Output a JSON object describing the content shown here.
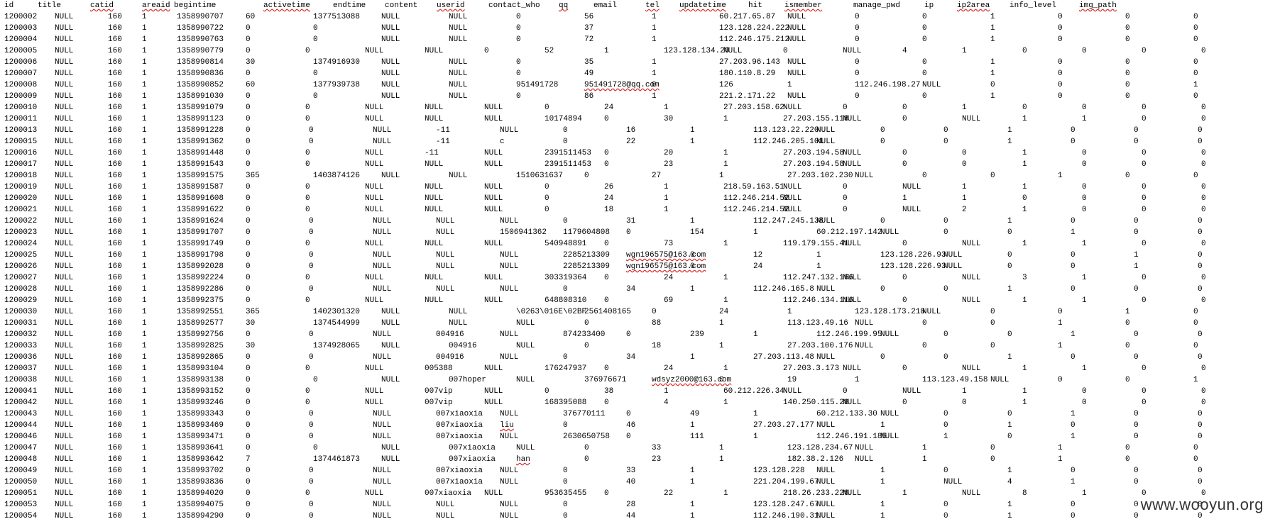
{
  "watermark": "www.wooyun.org",
  "header": [
    "id",
    "title",
    "catid",
    "areaid",
    "begintime",
    "activetime",
    "endtime",
    "content",
    "userid",
    "contact_who",
    "qq",
    "email",
    "tel",
    "updatetime",
    "hit",
    "ismember",
    "manage_pwd",
    "ip",
    "ip2area",
    "info_level",
    "img_path"
  ],
  "header_spellcheck": [
    "catid",
    "areaid",
    "activetime",
    "userid",
    "qq",
    "tel",
    "updatetime",
    "ismember",
    "ip2area",
    "img_path"
  ],
  "spellcheck_cells": [
    "@qq.com",
    "@163.com",
    "liu",
    "han"
  ],
  "rows": [
    [
      "1200002",
      "NULL",
      "160",
      "1",
      "1358990707",
      "60",
      "1377513088",
      "NULL",
      "NULL",
      "0",
      "56",
      "1",
      "60.217.65.87",
      "NULL",
      "0",
      "0",
      "1",
      "0",
      "0",
      "0"
    ],
    [
      "1200003",
      "NULL",
      "160",
      "1",
      "1358990722",
      "0",
      "0",
      "NULL",
      "NULL",
      "0",
      "37",
      "1",
      "123.128.224.222",
      "NULL",
      "0",
      "0",
      "1",
      "0",
      "0",
      "0"
    ],
    [
      "1200004",
      "NULL",
      "160",
      "1",
      "1358990763",
      "0",
      "0",
      "NULL",
      "NULL",
      "0",
      "72",
      "1",
      "112.246.175.212",
      "NULL",
      "0",
      "0",
      "1",
      "0",
      "0",
      "0"
    ],
    [
      "1200005",
      "NULL",
      "160",
      "1",
      "1358990779",
      "0",
      "0",
      "NULL",
      "NULL",
      "0",
      "52",
      "1",
      "123.128.134.20",
      "NULL",
      "0",
      "NULL",
      "4",
      "1",
      "0",
      "0",
      "0",
      "0"
    ],
    [
      "1200006",
      "NULL",
      "160",
      "1",
      "1358990814",
      "30",
      "1374916930",
      "NULL",
      "NULL",
      "0",
      "35",
      "1",
      "27.203.96.143",
      "NULL",
      "0",
      "0",
      "1",
      "0",
      "0",
      "0"
    ],
    [
      "1200007",
      "NULL",
      "160",
      "1",
      "1358990836",
      "0",
      "0",
      "NULL",
      "NULL",
      "0",
      "49",
      "1",
      "180.110.8.29",
      "NULL",
      "0",
      "0",
      "1",
      "0",
      "0",
      "0"
    ],
    [
      "1200008",
      "NULL",
      "160",
      "1",
      "1358990852",
      "60",
      "1377939738",
      "NULL",
      "NULL",
      "951491728",
      "951491728@qq.com",
      "0",
      "126",
      "1",
      "112.246.198.27",
      "NULL",
      "0",
      "0",
      "0",
      "1"
    ],
    [
      "1200009",
      "NULL",
      "160",
      "1",
      "1358991030",
      "0",
      "0",
      "NULL",
      "NULL",
      "0",
      "86",
      "1",
      "221.2.171.22",
      "NULL",
      "0",
      "0",
      "1",
      "0",
      "0",
      "0"
    ],
    [
      "1200010",
      "NULL",
      "160",
      "1",
      "1358991079",
      "0",
      "0",
      "NULL",
      "NULL",
      "NULL",
      "0",
      "24",
      "1",
      "27.203.158.62",
      "NULL",
      "0",
      "0",
      "1",
      "0",
      "0",
      "0",
      "0"
    ],
    [
      "1200011",
      "NULL",
      "160",
      "1",
      "1358991123",
      "0",
      "0",
      "NULL",
      "NULL",
      "NULL",
      "10174894",
      "0",
      "30",
      "1",
      "27.203.155.118",
      "NULL",
      "0",
      "NULL",
      "1",
      "1",
      "0",
      "0"
    ],
    [
      "1200013",
      "NULL",
      "160",
      "1",
      "1358991228",
      "0",
      "0",
      "NULL",
      "-11",
      "NULL",
      "0",
      "16",
      "1",
      "113.123.22.220",
      "NULL",
      "0",
      "0",
      "1",
      "0",
      "0",
      "0"
    ],
    [
      "1200015",
      "NULL",
      "160",
      "1",
      "1358991362",
      "0",
      "0",
      "NULL",
      "-11",
      "c",
      "0",
      "22",
      "1",
      "112.246.205.101",
      "NULL",
      "0",
      "0",
      "1",
      "0",
      "0",
      "0"
    ],
    [
      "1200016",
      "NULL",
      "160",
      "1",
      "1358991448",
      "0",
      "0",
      "NULL",
      "-11",
      "NULL",
      "2391511453",
      "0",
      "20",
      "1",
      "27.203.194.58",
      "NULL",
      "0",
      "0",
      "1",
      "0",
      "0",
      "0"
    ],
    [
      "1200017",
      "NULL",
      "160",
      "1",
      "1358991543",
      "0",
      "0",
      "NULL",
      "NULL",
      "NULL",
      "2391511453",
      "0",
      "23",
      "1",
      "27.203.194.58",
      "NULL",
      "0",
      "0",
      "1",
      "0",
      "0",
      "0"
    ],
    [
      "1200018",
      "NULL",
      "160",
      "1",
      "1358991575",
      "365",
      "1403874126",
      "NULL",
      "NULL",
      "1510631637",
      "0",
      "27",
      "1",
      "27.203.102.230",
      "NULL",
      "0",
      "0",
      "1",
      "0",
      "0"
    ],
    [
      "1200019",
      "NULL",
      "160",
      "1",
      "1358991587",
      "0",
      "0",
      "NULL",
      "NULL",
      "NULL",
      "0",
      "26",
      "1",
      "218.59.163.51",
      "NULL",
      "0",
      "NULL",
      "1",
      "1",
      "0",
      "0",
      "0"
    ],
    [
      "1200020",
      "NULL",
      "160",
      "1",
      "1358991608",
      "0",
      "0",
      "NULL",
      "NULL",
      "NULL",
      "0",
      "24",
      "1",
      "112.246.214.52",
      "NULL",
      "0",
      "1",
      "1",
      "0",
      "0",
      "0",
      "0"
    ],
    [
      "1200021",
      "NULL",
      "160",
      "1",
      "1358991622",
      "0",
      "0",
      "NULL",
      "NULL",
      "NULL",
      "0",
      "18",
      "1",
      "112.246.214.52",
      "NULL",
      "0",
      "NULL",
      "2",
      "1",
      "0",
      "0",
      "0"
    ],
    [
      "1200022",
      "NULL",
      "160",
      "1",
      "1358991624",
      "0",
      "0",
      "NULL",
      "NULL",
      "NULL",
      "0",
      "31",
      "1",
      "112.247.245.138",
      "NULL",
      "0",
      "0",
      "1",
      "0",
      "0",
      "0"
    ],
    [
      "1200023",
      "NULL",
      "160",
      "1",
      "1358991707",
      "0",
      "0",
      "NULL",
      "NULL",
      "1506941362",
      "1179604808",
      "0",
      "154",
      "1",
      "60.212.197.142",
      "NULL",
      "0",
      "0",
      "1",
      "0",
      "0"
    ],
    [
      "1200024",
      "NULL",
      "160",
      "1",
      "1358991749",
      "0",
      "0",
      "NULL",
      "NULL",
      "NULL",
      "540948891",
      "0",
      "73",
      "1",
      "119.179.155.41",
      "NULL",
      "0",
      "NULL",
      "1",
      "1",
      "0",
      "0"
    ],
    [
      "1200025",
      "NULL",
      "160",
      "1",
      "1358991798",
      "0",
      "0",
      "NULL",
      "NULL",
      "NULL",
      "2285213309",
      "wgn196575@163.com",
      "0",
      "12",
      "1",
      "123.128.226.93",
      "NULL",
      "0",
      "0",
      "1",
      "0"
    ],
    [
      "1200026",
      "NULL",
      "160",
      "1",
      "1358992028",
      "0",
      "0",
      "NULL",
      "NULL",
      "NULL",
      "2285213309",
      "wgn196575@163.com",
      "0",
      "24",
      "1",
      "123.128.226.93",
      "NULL",
      "0",
      "0",
      "1",
      "0"
    ],
    [
      "1200027",
      "NULL",
      "160",
      "1",
      "1358992224",
      "0",
      "0",
      "NULL",
      "NULL",
      "NULL",
      "303319364",
      "0",
      "24",
      "1",
      "112.247.132.166",
      "NULL",
      "0",
      "NULL",
      "3",
      "1",
      "0",
      "0"
    ],
    [
      "1200028",
      "NULL",
      "160",
      "1",
      "1358992286",
      "0",
      "0",
      "NULL",
      "NULL",
      "NULL",
      "0",
      "34",
      "1",
      "112.246.165.8",
      "NULL",
      "0",
      "0",
      "1",
      "0",
      "0",
      "0"
    ],
    [
      "1200029",
      "NULL",
      "160",
      "1",
      "1358992375",
      "0",
      "0",
      "NULL",
      "NULL",
      "NULL",
      "648808310",
      "0",
      "69",
      "1",
      "112.246.134.116",
      "NULL",
      "0",
      "NULL",
      "1",
      "1",
      "0",
      "0"
    ],
    [
      "1200030",
      "NULL",
      "160",
      "1",
      "1358992551",
      "365",
      "1402301320",
      "NULL",
      "NULL",
      "\\0263\\016E\\02BF",
      "2561408165",
      "0",
      "24",
      "1",
      "123.128.173.218",
      "NULL",
      "0",
      "0",
      "1",
      "0"
    ],
    [
      "1200031",
      "NULL",
      "160",
      "1",
      "1358992577",
      "30",
      "1374544999",
      "NULL",
      "NULL",
      "NULL",
      "0",
      "88",
      "1",
      "113.123.49.16",
      "NULL",
      "0",
      "0",
      "1",
      "0",
      "0"
    ],
    [
      "1200032",
      "NULL",
      "160",
      "1",
      "1358992756",
      "0",
      "0",
      "NULL",
      "004916",
      "NULL",
      "874233400",
      "0",
      "239",
      "1",
      "112.246.199.95",
      "NULL",
      "0",
      "0",
      "1",
      "0",
      "0"
    ],
    [
      "1200033",
      "NULL",
      "160",
      "1",
      "1358992825",
      "30",
      "1374928065",
      "NULL",
      "004916",
      "NULL",
      "0",
      "18",
      "1",
      "27.203.100.176",
      "NULL",
      "0",
      "0",
      "1",
      "0",
      "0"
    ],
    [
      "1200036",
      "NULL",
      "160",
      "1",
      "1358992865",
      "0",
      "0",
      "NULL",
      "004916",
      "NULL",
      "0",
      "34",
      "1",
      "27.203.113.48",
      "NULL",
      "0",
      "0",
      "1",
      "0",
      "0",
      "0"
    ],
    [
      "1200037",
      "NULL",
      "160",
      "1",
      "1358993104",
      "0",
      "0",
      "NULL",
      "005388",
      "NULL",
      "176247937",
      "0",
      "24",
      "1",
      "27.203.3.173",
      "NULL",
      "0",
      "NULL",
      "1",
      "1",
      "0",
      "0"
    ],
    [
      "1200038",
      "NULL",
      "160",
      "1",
      "1358993138",
      "0",
      "0",
      "NULL",
      "007hoper",
      "NULL",
      "376976671",
      "wdsyz2000@163.com",
      "0",
      "19",
      "1",
      "113.123.49.158",
      "NULL",
      "0",
      "0",
      "1"
    ],
    [
      "1200041",
      "NULL",
      "160",
      "1",
      "1358993152",
      "0",
      "0",
      "NULL",
      "007vip",
      "NULL",
      "0",
      "38",
      "1",
      "60.212.226.34",
      "NULL",
      "0",
      "NULL",
      "1",
      "1",
      "0",
      "0",
      "0"
    ],
    [
      "1200042",
      "NULL",
      "160",
      "1",
      "1358993246",
      "0",
      "0",
      "NULL",
      "007vip",
      "NULL",
      "168395088",
      "0",
      "4",
      "1",
      "140.250.115.28",
      "NULL",
      "0",
      "0",
      "1",
      "0",
      "0",
      "0"
    ],
    [
      "1200043",
      "NULL",
      "160",
      "1",
      "1358993343",
      "0",
      "0",
      "NULL",
      "007xiaoxia",
      "NULL",
      "376770111",
      "0",
      "49",
      "1",
      "60.212.133.30",
      "NULL",
      "0",
      "0",
      "1",
      "0",
      "0"
    ],
    [
      "1200044",
      "NULL",
      "160",
      "1",
      "1358993469",
      "0",
      "0",
      "NULL",
      "007xiaoxia",
      "liu",
      "0",
      "46",
      "1",
      "27.203.27.177",
      "NULL",
      "1",
      "0",
      "1",
      "0",
      "0",
      "0"
    ],
    [
      "1200046",
      "NULL",
      "160",
      "1",
      "1358993471",
      "0",
      "0",
      "NULL",
      "007xiaoxia",
      "NULL",
      "2630650758",
      "0",
      "111",
      "1",
      "112.246.191.185",
      "NULL",
      "1",
      "0",
      "1",
      "0",
      "0"
    ],
    [
      "1200047",
      "NULL",
      "160",
      "1",
      "1358993641",
      "0",
      "0",
      "NULL",
      "007xiaoxia",
      "NULL",
      "0",
      "33",
      "1",
      "123.128.234.67",
      "NULL",
      "1",
      "0",
      "1",
      "0",
      "0"
    ],
    [
      "1200048",
      "NULL",
      "160",
      "1",
      "1358993642",
      "7",
      "1374461873",
      "NULL",
      "007xiaoxia",
      "han",
      "0",
      "23",
      "1",
      "182.38.2.126",
      "NULL",
      "1",
      "0",
      "1",
      "0",
      "0"
    ],
    [
      "1200049",
      "NULL",
      "160",
      "1",
      "1358993702",
      "0",
      "0",
      "NULL",
      "007xiaoxia",
      "NULL",
      "0",
      "33",
      "1",
      "123.128.228",
      "NULL",
      "1",
      "0",
      "1",
      "0",
      "0",
      "0"
    ],
    [
      "1200050",
      "NULL",
      "160",
      "1",
      "1358993836",
      "0",
      "0",
      "NULL",
      "007xiaoxia",
      "NULL",
      "0",
      "40",
      "1",
      "221.204.199.67",
      "NULL",
      "1",
      "NULL",
      "4",
      "1",
      "0",
      "0"
    ],
    [
      "1200051",
      "NULL",
      "160",
      "1",
      "1358994020",
      "0",
      "0",
      "NULL",
      "007xiaoxia",
      "NULL",
      "953635455",
      "0",
      "22",
      "1",
      "218.26.233.226",
      "NULL",
      "1",
      "NULL",
      "8",
      "1",
      "0",
      "0"
    ],
    [
      "1200053",
      "NULL",
      "160",
      "1",
      "1358994075",
      "0",
      "0",
      "NULL",
      "NULL",
      "NULL",
      "0",
      "28",
      "1",
      "123.128.247.67",
      "NULL",
      "1",
      "0",
      "1",
      "0",
      "0",
      "0"
    ],
    [
      "1200054",
      "NULL",
      "160",
      "1",
      "1358994290",
      "0",
      "0",
      "NULL",
      "NULL",
      "NULL",
      "0",
      "44",
      "1",
      "112.246.190.31",
      "NULL",
      "1",
      "0",
      "1",
      "0",
      "0",
      "0"
    ]
  ]
}
